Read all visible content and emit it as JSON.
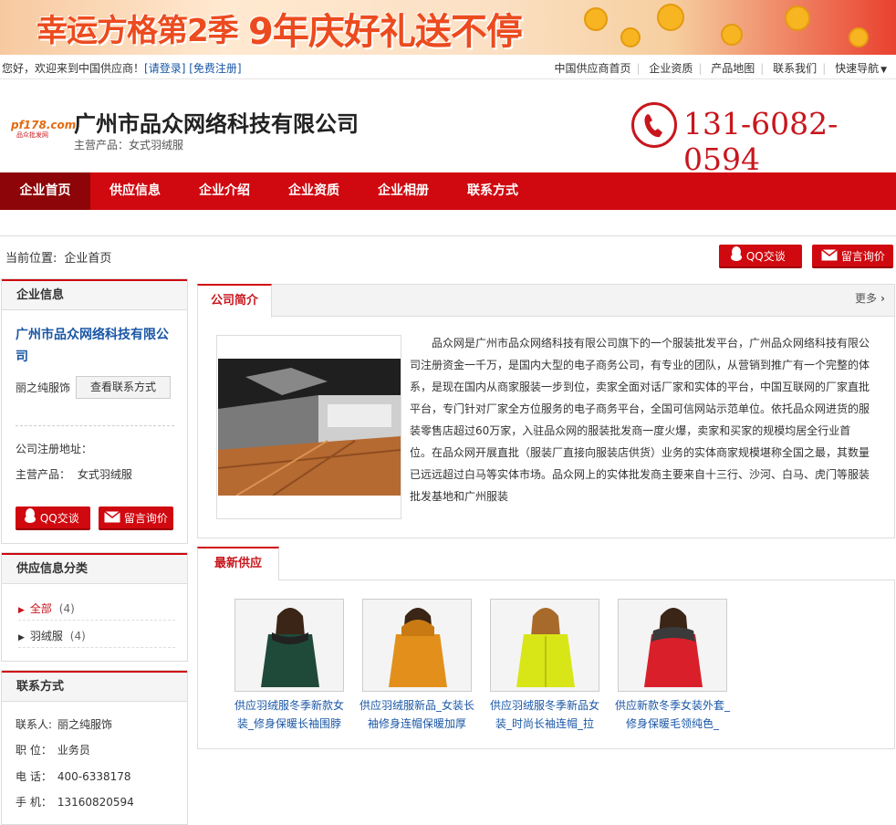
{
  "banner": {
    "text_left": "幸运方格第2季",
    "text_right": "9年庆好礼送不停"
  },
  "topbar": {
    "welcome": "您好，欢迎来到中国供应商！",
    "login": "[请登录]",
    "register": "[免费注册]",
    "nav": [
      "中国供应商首页",
      "企业资质",
      "产品地图",
      "联系我们",
      "快速导航"
    ]
  },
  "header": {
    "logo_text": "pf178.com",
    "logo_sub": "品众批发网",
    "company_name": "广州市品众网络科技有限公司",
    "main_products": "主营产品：女式羽绒服",
    "phone": "131-6082-0594"
  },
  "navbar": {
    "items": [
      "企业首页",
      "供应信息",
      "企业介绍",
      "企业资质",
      "企业相册",
      "联系方式"
    ]
  },
  "breadcrumb": {
    "prefix": "当前位置:",
    "current": "企业首页"
  },
  "actions": {
    "qq": "QQ交谈",
    "message": "留言询价"
  },
  "company_info": {
    "title": "企业信息",
    "name": "广州市品众网络科技有限公司",
    "contact_person": "丽之纯服饰",
    "view_contact": "查看联系方式",
    "address_label": "公司注册地址：",
    "products_label": "主营产品：",
    "products_value": "女式羽绒服",
    "qq": "QQ交谈",
    "message": "留言询价"
  },
  "categories": {
    "title": "供应信息分类",
    "items": [
      {
        "label": "全部",
        "count": "(4)"
      },
      {
        "label": "羽绒服",
        "count": "(4)"
      }
    ]
  },
  "contact": {
    "title": "联系方式",
    "rows": [
      {
        "label": "联系人:",
        "value": "丽之纯服饰"
      },
      {
        "label": "职 位：",
        "value": "业务员"
      },
      {
        "label": "电 话：",
        "value": "400-6338178"
      },
      {
        "label": "手 机：",
        "value": "13160820594"
      }
    ]
  },
  "intro": {
    "tab": "公司简介",
    "more": "更多",
    "text": "品众网是广州市品众网络科技有限公司旗下的一个服装批发平台，广州品众网络科技有限公司注册资金一千万，是国内大型的电子商务公司，有专业的团队，从营销到推广有一个完整的体系，是现在国内从商家服装一步到位，卖家全面对话厂家和实体的平台，中国互联网的厂家直批平台，专门针对厂家全方位服务的电子商务平台，全国可信网站示范单位。依托品众网进货的服装零售店超过60万家，入驻品众网的服装批发商一度火爆，卖家和买家的规模均居全行业首位。在品众网开展直批（服装厂直接向服装店供货）业务的实体商家规模堪称全国之最，其数量已远远超过白马等实体市场。品众网上的实体批发商主要来自十三行、沙河、白马、虎门等服装批发基地和广州服装"
  },
  "latest": {
    "tab": "最新供应",
    "products": [
      {
        "name": "供应羽绒服冬季新款女装_修身保暖长袖围脖",
        "color": "#1f4a3a"
      },
      {
        "name": "供应羽绒服新品_女装长袖修身连帽保暖加厚",
        "color": "#e2901b"
      },
      {
        "name": "供应羽绒服冬季新品女装_时尚长袖连帽_拉",
        "color": "#d8e617"
      },
      {
        "name": "供应新款冬季女装外套_修身保暖毛领纯色_",
        "color": "#d9202a"
      }
    ]
  }
}
